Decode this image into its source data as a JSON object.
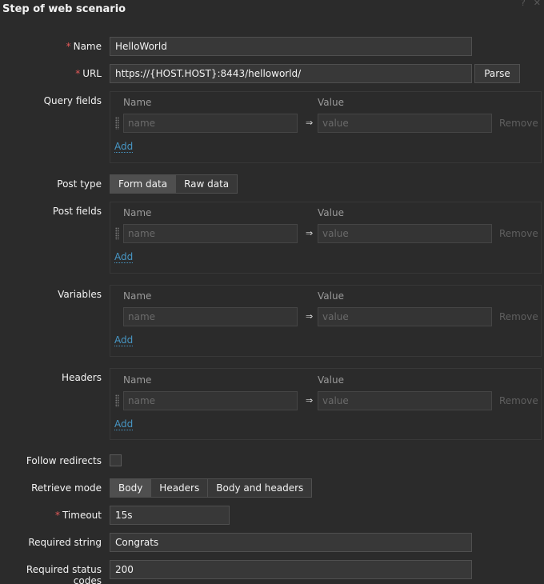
{
  "dialog": {
    "title": "Step of web scenario",
    "help_icon": "?",
    "close_icon": "✕"
  },
  "form": {
    "name": {
      "label": "Name",
      "value": "HelloWorld"
    },
    "url": {
      "label": "URL",
      "value": "https://{HOST.HOST}:8443/helloworld/",
      "parse_label": "Parse"
    },
    "query_fields": {
      "label": "Query fields"
    },
    "post_type": {
      "label": "Post type",
      "options": [
        "Form data",
        "Raw data"
      ],
      "selected": "Form data"
    },
    "post_fields": {
      "label": "Post fields"
    },
    "variables": {
      "label": "Variables"
    },
    "headers": {
      "label": "Headers"
    },
    "follow_redirects": {
      "label": "Follow redirects",
      "checked": false
    },
    "retrieve_mode": {
      "label": "Retrieve mode",
      "options": [
        "Body",
        "Headers",
        "Body and headers"
      ],
      "selected": "Body"
    },
    "timeout": {
      "label": "Timeout",
      "value": "15s"
    },
    "required_string": {
      "label": "Required string",
      "value": "Congrats"
    },
    "required_status_codes": {
      "label": "Required status codes",
      "value": "200"
    }
  },
  "pair_table": {
    "name_header": "Name",
    "value_header": "Value",
    "name_placeholder": "name",
    "value_placeholder": "value",
    "arrow": "⇒",
    "remove_label": "Remove",
    "add_label": "Add"
  }
}
